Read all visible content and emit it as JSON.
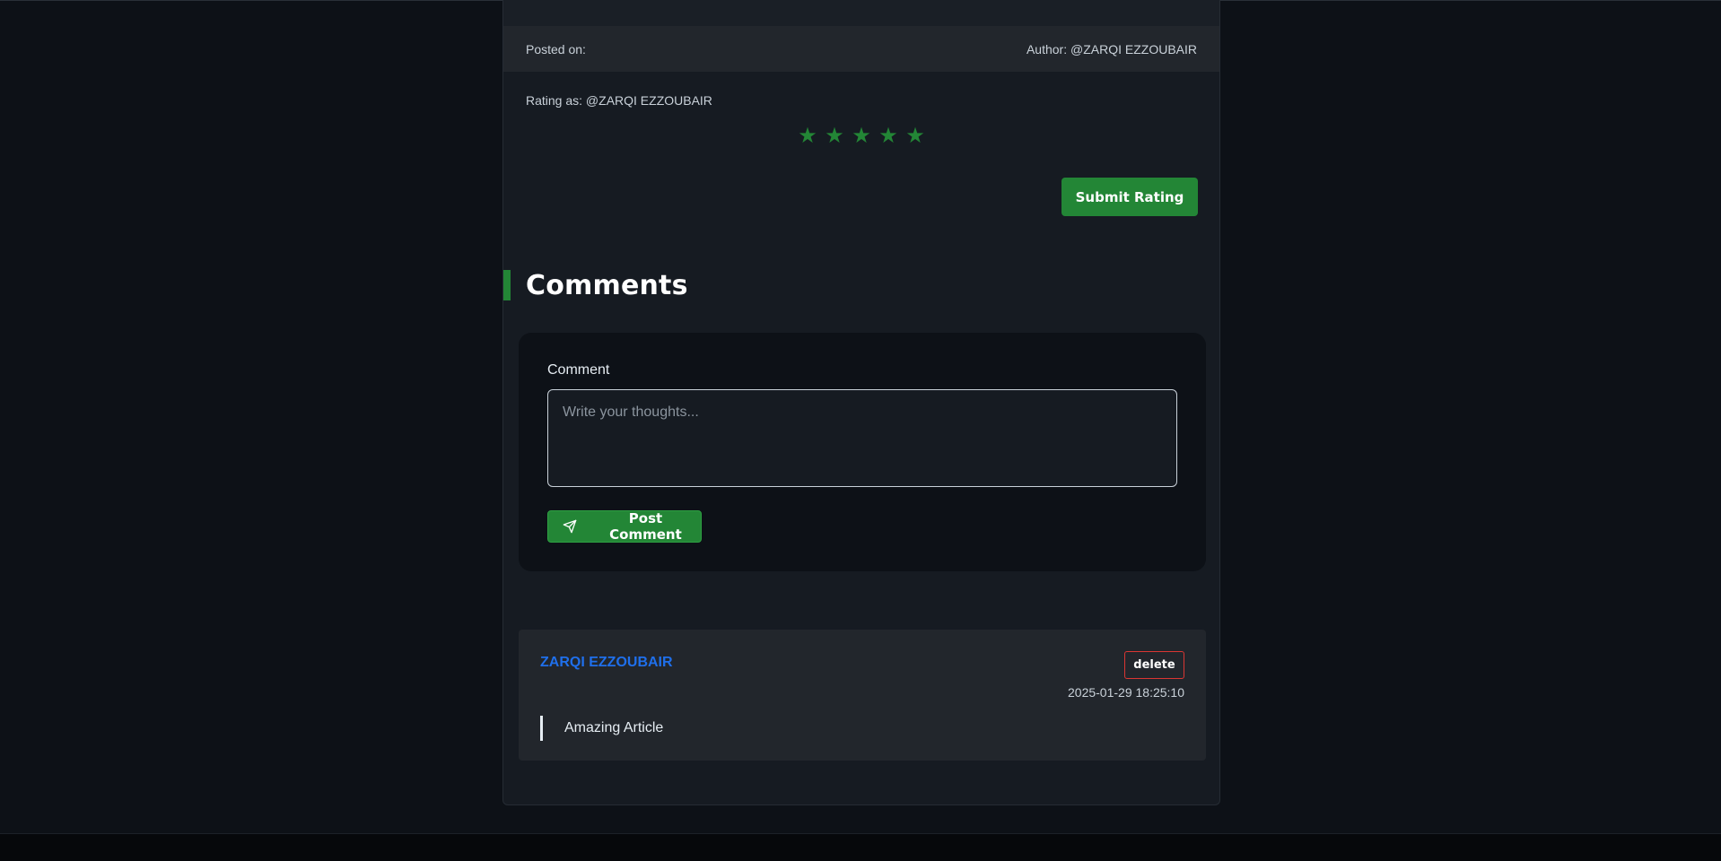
{
  "post_meta": {
    "posted_on_label": "Posted on:",
    "author_label": "Author: @ZARQI EZZOUBAIR"
  },
  "rating": {
    "rating_as": "Rating as: @ZARQI EZZOUBAIR",
    "stars": [
      "★",
      "★",
      "★",
      "★",
      "★"
    ],
    "submit_label": "Submit Rating"
  },
  "comments": {
    "heading": "Comments",
    "form": {
      "label": "Comment",
      "placeholder": "Write your thoughts...",
      "post_label": "Post Comment",
      "post_icon": "send-icon"
    },
    "items": [
      {
        "author": "ZARQI EZZOUBAIR",
        "delete_label": "delete",
        "timestamp": "2025-01-29 18:25:10",
        "body": "Amazing Article"
      }
    ]
  },
  "colors": {
    "accent_green": "#238636",
    "link_blue": "#1f6feb",
    "danger_red": "#da3633",
    "background": "#0d1117",
    "card": "#161b22"
  }
}
